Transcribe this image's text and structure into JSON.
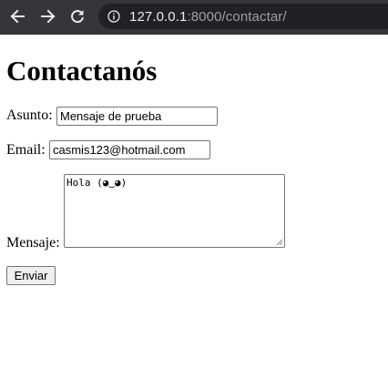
{
  "browser": {
    "url_host": "127.0.0.1",
    "url_rest": ":8000/contactar/"
  },
  "page": {
    "title": "Contactanós"
  },
  "form": {
    "asunto_label": "Asunto:",
    "asunto_value": "Mensaje de prueba",
    "email_label": "Email:",
    "email_value": "casmis123@hotmail.com",
    "mensaje_label": "Mensaje:",
    "mensaje_value": "Hola (◕‿◕)",
    "submit_label": "Enviar"
  },
  "colors": {
    "toolbar": "#35363a",
    "omnibox": "#202124",
    "url_host": "#e8eaed",
    "url_rest": "#9aa0a6"
  },
  "icons": [
    "back-arrow-icon",
    "forward-arrow-icon",
    "reload-icon",
    "info-icon"
  ]
}
